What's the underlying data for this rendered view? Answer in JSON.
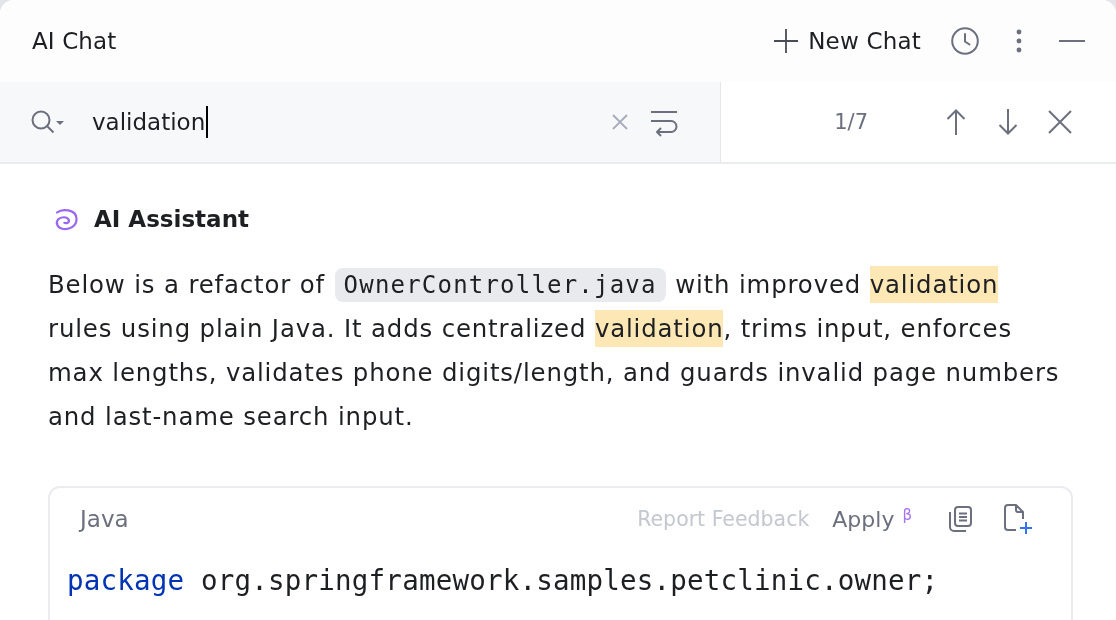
{
  "header": {
    "title": "AI Chat",
    "new_chat": "New Chat"
  },
  "find": {
    "value": "validation",
    "match_count": "1/7"
  },
  "message": {
    "author": "AI Assistant",
    "segments": [
      {
        "kind": "text",
        "text": "Below is a refactor of "
      },
      {
        "kind": "code",
        "text": "OwnerController.java"
      },
      {
        "kind": "text",
        "text": " with improved "
      },
      {
        "kind": "match",
        "text": "validation"
      },
      {
        "kind": "text",
        "text": " rules using plain Java. It adds centralized "
      },
      {
        "kind": "match",
        "text": "validation"
      },
      {
        "kind": "text",
        "text": ", trims input, enforces max lengths, validates phone digits/length, and guards invalid page numbers and last-name search input."
      }
    ]
  },
  "code_block": {
    "language": "Java",
    "report_feedback": "Report Feedback",
    "apply": "Apply $^{β}$",
    "lines": [
      {
        "tokens": [
          {
            "kind": "keyword",
            "text": "package"
          },
          {
            "kind": "plain",
            "text": " org.springframework.samples.petclinic.owner;"
          }
        ]
      }
    ]
  }
}
